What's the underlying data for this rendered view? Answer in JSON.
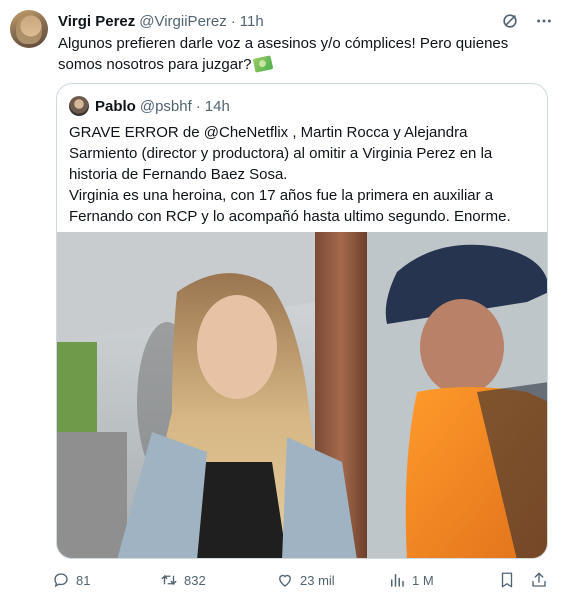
{
  "author": {
    "name": "Virgi Perez",
    "handle": "@VirgiiPerez",
    "separator": "·",
    "time": "11h"
  },
  "tweet": {
    "text": "Algunos prefieren darle voz a asesinos y/o cómplices! Pero quienes somos nosotros para juzgar?"
  },
  "quoted": {
    "name": "Pablo",
    "handle": "@psbhf",
    "separator": "·",
    "time": "14h",
    "line1": "GRAVE ERROR de @CheNetflix , Martin Rocca y Alejandra Sarmiento (director y productora) al omitir a Virginia Perez en la historia de Fernando Baez Sosa.",
    "line2": "Virginia es una heroina, con 17 años fue la primera en auxiliar a Fernando con RCP y lo acompañó hasta ultimo segundo. Enorme."
  },
  "metrics": {
    "replies": "81",
    "retweets": "832",
    "likes": "23 mil",
    "views": "1 M"
  },
  "icons": {
    "grok": "grok-icon",
    "more": "more-icon",
    "emoji": "money-with-wings-emoji",
    "reply": "reply-icon",
    "retweet": "retweet-icon",
    "like": "heart-icon",
    "views": "views-icon",
    "bookmark": "bookmark-icon",
    "share": "share-icon"
  },
  "colors": {
    "text": "#0f1419",
    "secondary": "#536471",
    "border": "#cfd9de"
  }
}
